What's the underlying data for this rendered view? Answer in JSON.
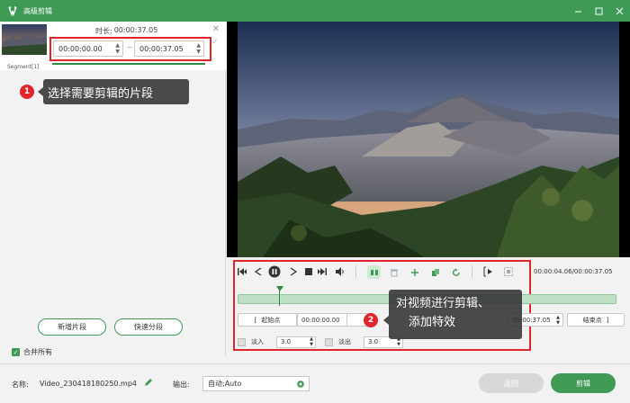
{
  "window": {
    "title": "高级剪辑",
    "controls": [
      "minimize",
      "restore",
      "close"
    ]
  },
  "segment": {
    "duration_label": "时长:",
    "duration": "00:00:37.05",
    "start_time": "00:00:00.00",
    "end_time": "00:00:37.05",
    "separator": "~",
    "label": "Segment[1]"
  },
  "callout1": {
    "number": "1",
    "text": "选择需要剪辑的片段"
  },
  "callout2": {
    "number": "2",
    "line1": "对视频进行剪辑、",
    "line2": "添加特效"
  },
  "left_buttons": {
    "new_segment": "新增片段",
    "quick_split": "快速分段"
  },
  "merge_all": {
    "label": "合并所有",
    "checked": true
  },
  "player": {
    "timecode": "00:00:04.06/00:00:37.05",
    "playhead_fraction": 0.11
  },
  "trim": {
    "start_btn": "起始点",
    "start_value": "00:00:00.00",
    "end_value": "00:00:37.05",
    "end_btn": "结束点",
    "start_mid_visible": "5"
  },
  "fade": {
    "in_label": "淡入",
    "in_value": "3.0",
    "out_label": "淡出",
    "out_value": "3.0"
  },
  "bottom": {
    "name_label": "名称:",
    "file_name": "Video_230418180250.mp4",
    "output_label": "输出:",
    "output_value": "自动;Auto",
    "back_btn": "返回",
    "cut_btn": "剪辑"
  },
  "colors": {
    "accent": "#3e9a55",
    "highlight": "#e0252b"
  }
}
